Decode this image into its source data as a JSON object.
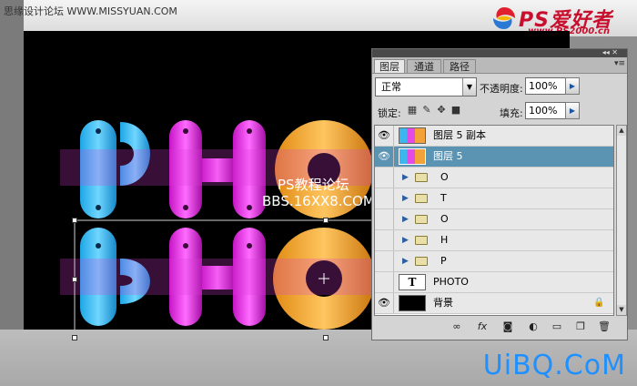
{
  "site": {
    "top_text": "思缘设计论坛 WWW.MISSYUAN.COM",
    "logo_main": "PS爱好者",
    "logo_sub": "www.PS2000.cn",
    "watermark": "UiBQ.CoM"
  },
  "canvas": {
    "overlay_title": "PS教程论坛",
    "overlay_url": "BBS.16XX8.COM",
    "artwork_letters": [
      "P",
      "H",
      "O"
    ]
  },
  "layers_panel": {
    "tabs": [
      "图层",
      "通道",
      "路径"
    ],
    "blend_mode": "正常",
    "opacity_label": "不透明度:",
    "opacity_value": "100%",
    "lock_label": "锁定:",
    "fill_label": "填充:",
    "fill_value": "100%",
    "layers": [
      {
        "name": "图层 5 副本",
        "visible": true,
        "type": "image",
        "selected": false
      },
      {
        "name": "图层 5",
        "visible": true,
        "type": "image",
        "selected": true
      },
      {
        "name": "O",
        "visible": false,
        "type": "group",
        "selected": false
      },
      {
        "name": "T",
        "visible": false,
        "type": "group",
        "selected": false
      },
      {
        "name": "O",
        "visible": false,
        "type": "group",
        "selected": false
      },
      {
        "name": "H",
        "visible": false,
        "type": "group",
        "selected": false
      },
      {
        "name": "P",
        "visible": false,
        "type": "group",
        "selected": false
      },
      {
        "name": "PHOTO",
        "visible": false,
        "type": "text",
        "selected": false
      },
      {
        "name": "背景",
        "visible": true,
        "type": "background",
        "selected": false
      }
    ],
    "bottom_icons": [
      "link-icon",
      "fx-icon",
      "mask-icon",
      "adjustment-icon",
      "group-icon",
      "new-layer-icon",
      "trash-icon"
    ]
  }
}
